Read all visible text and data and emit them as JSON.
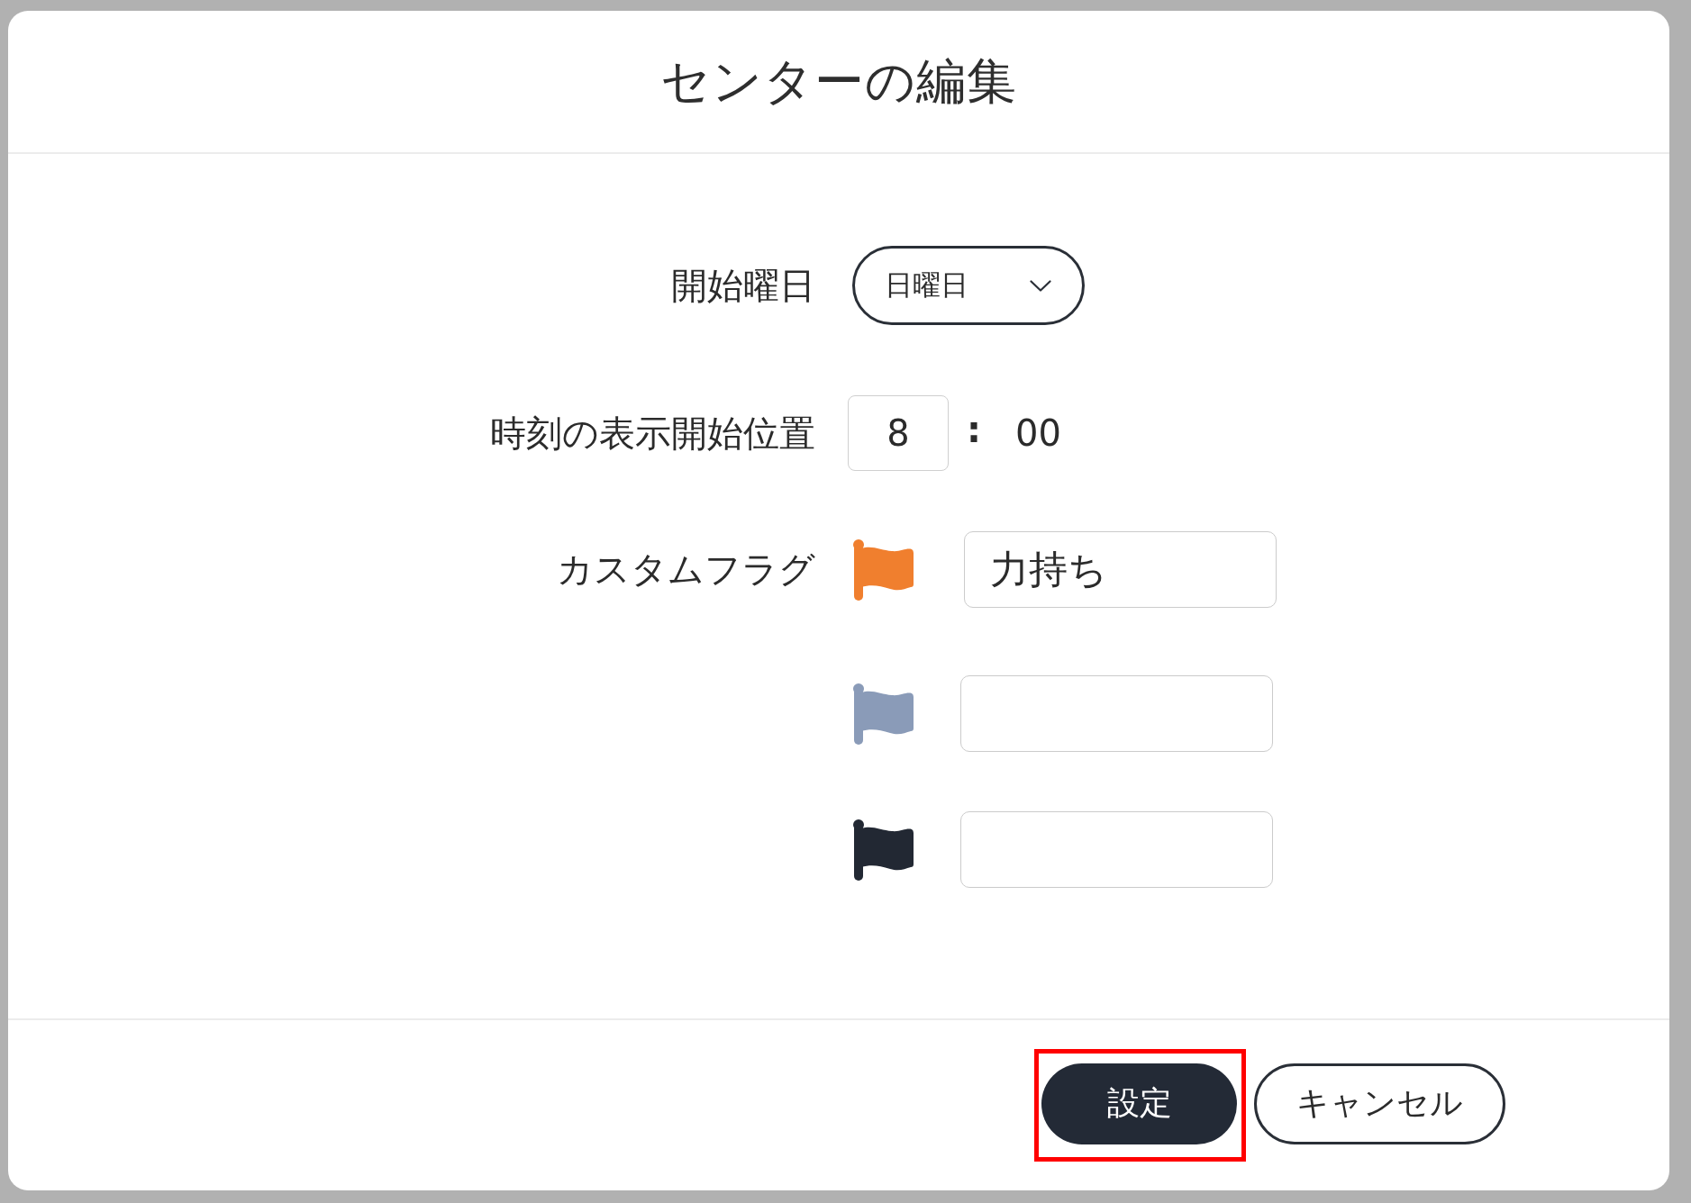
{
  "dialog": {
    "title": "センターの編集"
  },
  "form": {
    "start_day": {
      "label": "開始曜日",
      "value": "日曜日"
    },
    "display_start_time": {
      "label": "時刻の表示開始位置",
      "hour": "8",
      "separator": ":",
      "minutes": "00"
    },
    "custom_flags": {
      "label": "カスタムフラグ",
      "flags": [
        {
          "color": "#f07f2e",
          "value": "力持ち"
        },
        {
          "color": "#8a9bb8"
        },
        {
          "color": "#222833"
        }
      ]
    }
  },
  "buttons": [
    {
      "label": "設定",
      "kind": "primary",
      "highlighted": true
    },
    {
      "label": "キャンセル",
      "kind": "secondary",
      "highlighted": false
    }
  ]
}
